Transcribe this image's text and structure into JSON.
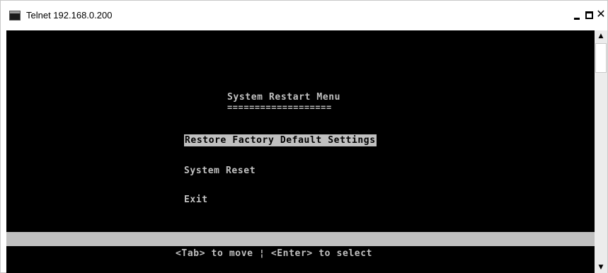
{
  "window": {
    "title": "Telnet 192.168.0.200",
    "icon": "telnet-terminal-icon",
    "controls": {
      "minimize": "minimize-icon",
      "maximize": "maximize-icon",
      "close": "close-icon"
    }
  },
  "terminal": {
    "menu_title": "System Restart Menu",
    "menu_underline": "===================",
    "items": [
      {
        "label": "Restore Factory Default Settings",
        "selected": true
      },
      {
        "label": "System Reset",
        "selected": false
      },
      {
        "label": "Exit",
        "selected": false
      }
    ],
    "hint": "<Tab> to move ¦ <Enter> to select"
  },
  "colors": {
    "terminal_bg": "#000000",
    "terminal_fg": "#c0c0c0",
    "highlight_bg": "#c0c0c0",
    "highlight_fg": "#000000"
  },
  "scrollbar": {
    "up_icon": "scroll-up-arrow-icon",
    "down_icon": "scroll-down-arrow-icon"
  }
}
